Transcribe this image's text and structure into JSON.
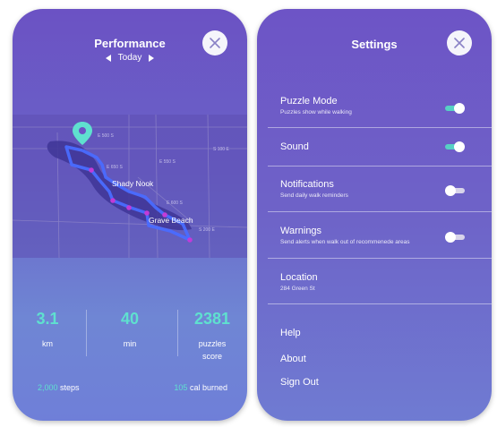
{
  "performance": {
    "title": "Performance",
    "day": "Today",
    "map_labels": {
      "shady_nook": "Shady Nook",
      "grave_beach": "Grave Beach",
      "road_a": "E 500 S",
      "road_b": "E 550 S",
      "road_c": "E 600 S",
      "road_d": "E 650 S",
      "road_e": "S 100 E",
      "road_f": "S 200 E"
    },
    "stats": [
      {
        "value": "3.1",
        "label": "km"
      },
      {
        "value": "40",
        "label": "min"
      },
      {
        "value": "2381",
        "label": "puzzles score"
      }
    ],
    "steps_value": "2,000",
    "steps_label": "steps",
    "cal_value": "105",
    "cal_label": "cal burned",
    "colors": {
      "accent": "#5fe0cf",
      "route": "#4a6bff",
      "waypoint": "#c23bd8"
    }
  },
  "settings": {
    "title": "Settings",
    "items": [
      {
        "label": "Puzzle Mode",
        "sub": "Puzzles show while walking",
        "toggle": "on"
      },
      {
        "label": "Sound",
        "sub": "",
        "toggle": "on"
      },
      {
        "label": "Notifications",
        "sub": "Send daily walk reminders",
        "toggle": "off"
      },
      {
        "label": "Warnings",
        "sub": "Send alerts when walk out of recommenede areas",
        "toggle": "off"
      },
      {
        "label": "Location",
        "sub": "284 Green St"
      }
    ],
    "links": [
      "Help",
      "About",
      "Sign Out"
    ]
  }
}
